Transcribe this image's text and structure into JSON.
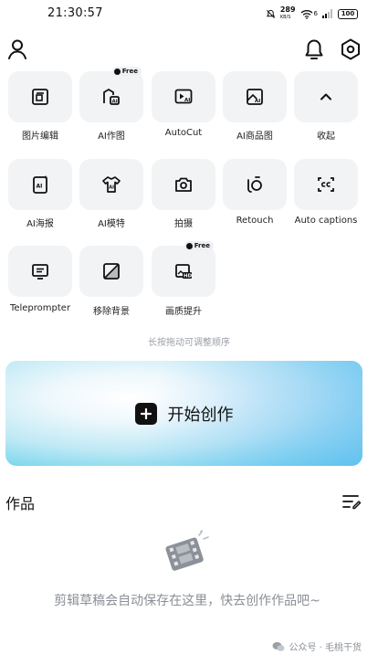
{
  "status_bar": {
    "time": "21:30:57",
    "speed_value": "289",
    "speed_unit": "KB/S",
    "network": "6",
    "battery": "100"
  },
  "tools": [
    {
      "label": "图片编辑",
      "icon": "image-edit-icon"
    },
    {
      "label": "AI作图",
      "icon": "ai-drawing-icon",
      "badge": "Free"
    },
    {
      "label": "AutoCut",
      "icon": "autocut-icon"
    },
    {
      "label": "AI商品图",
      "icon": "ai-product-image-icon"
    },
    {
      "label": "收起",
      "icon": "chevron-up-icon"
    },
    {
      "label": "AI海报",
      "icon": "ai-poster-icon"
    },
    {
      "label": "AI模特",
      "icon": "ai-model-icon"
    },
    {
      "label": "拍摄",
      "icon": "camera-icon"
    },
    {
      "label": "Retouch",
      "icon": "retouch-icon"
    },
    {
      "label": "Auto captions",
      "icon": "auto-captions-icon"
    },
    {
      "label": "Teleprompter",
      "icon": "teleprompter-icon"
    },
    {
      "label": "移除背景",
      "icon": "remove-background-icon"
    },
    {
      "label": "画质提升",
      "icon": "hd-enhance-icon",
      "badge": "Free"
    }
  ],
  "hint": "长按拖动可调整顺序",
  "create_button": {
    "label": "开始创作"
  },
  "works": {
    "title": "作品",
    "empty_text": "剪辑草稿会自动保存在这里，快去创作作品吧~"
  },
  "watermark": "公众号 · 毛桃干货"
}
